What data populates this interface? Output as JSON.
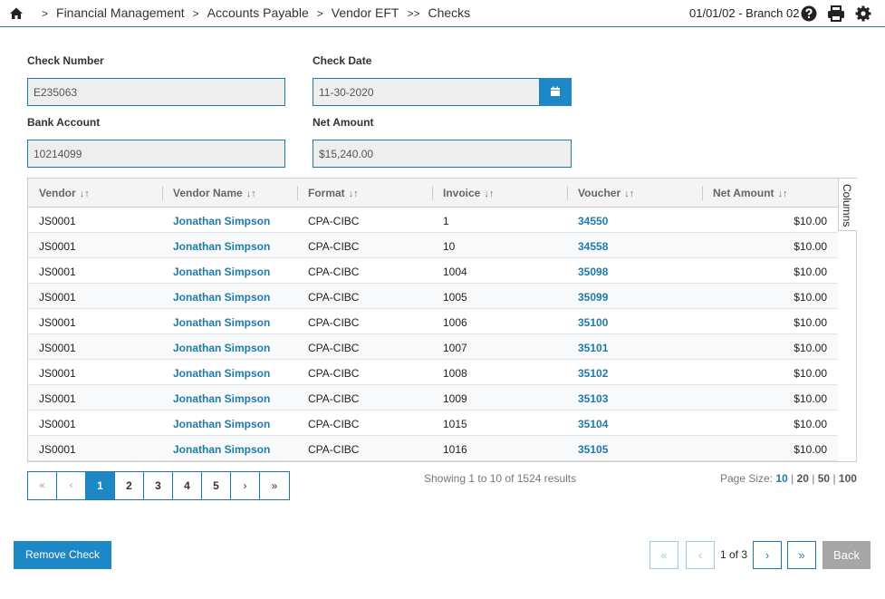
{
  "header": {
    "breadcrumbs": [
      {
        "sep": ">",
        "label": "Financial Management"
      },
      {
        "sep": ">",
        "label": "Accounts Payable"
      },
      {
        "sep": ">",
        "label": "Vendor EFT"
      },
      {
        "sep": ">>",
        "label": "Checks"
      }
    ],
    "branch_info": "01/01/02 - Branch 02",
    "icons": [
      "home-icon",
      "help-icon",
      "print-icon",
      "gear-icon"
    ]
  },
  "form": {
    "check_number_label": "Check Number",
    "check_number_value": "E235063",
    "check_date_label": "Check Date",
    "check_date_value": "11-30-2020",
    "bank_account_label": "Bank Account",
    "bank_account_value": "10214099",
    "net_amount_label": "Net Amount",
    "net_amount_value": "$15,240.00"
  },
  "table": {
    "columns_tab": "Columns",
    "sort_glyph": "↓↑",
    "headers": [
      "Vendor",
      "Vendor Name",
      "Format",
      "Invoice",
      "Voucher",
      "Net Amount"
    ],
    "rows": [
      {
        "vendor": "JS0001",
        "name": "Jonathan Simpson",
        "format": "CPA-CIBC",
        "invoice": "1",
        "voucher": "34550",
        "amount": "$10.00"
      },
      {
        "vendor": "JS0001",
        "name": "Jonathan Simpson",
        "format": "CPA-CIBC",
        "invoice": "10",
        "voucher": "34558",
        "amount": "$10.00"
      },
      {
        "vendor": "JS0001",
        "name": "Jonathan Simpson",
        "format": "CPA-CIBC",
        "invoice": "1004",
        "voucher": "35098",
        "amount": "$10.00"
      },
      {
        "vendor": "JS0001",
        "name": "Jonathan Simpson",
        "format": "CPA-CIBC",
        "invoice": "1005",
        "voucher": "35099",
        "amount": "$10.00"
      },
      {
        "vendor": "JS0001",
        "name": "Jonathan Simpson",
        "format": "CPA-CIBC",
        "invoice": "1006",
        "voucher": "35100",
        "amount": "$10.00"
      },
      {
        "vendor": "JS0001",
        "name": "Jonathan Simpson",
        "format": "CPA-CIBC",
        "invoice": "1007",
        "voucher": "35101",
        "amount": "$10.00"
      },
      {
        "vendor": "JS0001",
        "name": "Jonathan Simpson",
        "format": "CPA-CIBC",
        "invoice": "1008",
        "voucher": "35102",
        "amount": "$10.00"
      },
      {
        "vendor": "JS0001",
        "name": "Jonathan Simpson",
        "format": "CPA-CIBC",
        "invoice": "1009",
        "voucher": "35103",
        "amount": "$10.00"
      },
      {
        "vendor": "JS0001",
        "name": "Jonathan Simpson",
        "format": "CPA-CIBC",
        "invoice": "1015",
        "voucher": "35104",
        "amount": "$10.00"
      },
      {
        "vendor": "JS0001",
        "name": "Jonathan Simpson",
        "format": "CPA-CIBC",
        "invoice": "1016",
        "voucher": "35105",
        "amount": "$10.00"
      }
    ]
  },
  "pager": {
    "first": "«",
    "prev": "‹",
    "pages": [
      "1",
      "2",
      "3",
      "4",
      "5"
    ],
    "active_page": "1",
    "next": "›",
    "last": "»",
    "showing_text": "Showing 1 to 10 of 1524 results",
    "page_size_label": "Page Size:",
    "page_sizes": [
      "10",
      "20",
      "50",
      "100"
    ],
    "page_size_selected": "10",
    "page_size_sep": "|"
  },
  "footer": {
    "remove_label": "Remove Check",
    "first": "«",
    "prev": "‹",
    "page_of": "1 of 3",
    "next": "›",
    "last": "»",
    "back_label": "Back"
  },
  "colors": {
    "accent": "#1e88c7",
    "link": "#1f7aa8",
    "back_button": "#a6a6a6"
  }
}
